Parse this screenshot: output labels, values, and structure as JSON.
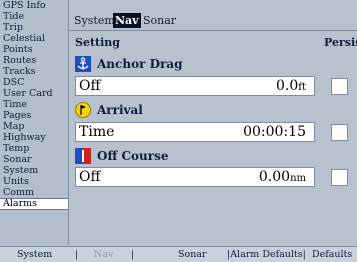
{
  "sidebar": {
    "items": [
      {
        "label": "GPS Info"
      },
      {
        "label": "Tide"
      },
      {
        "label": "Trip"
      },
      {
        "label": "Celestial"
      },
      {
        "label": "Points"
      },
      {
        "label": "Routes"
      },
      {
        "label": "Tracks"
      },
      {
        "label": "DSC"
      },
      {
        "label": "User Card"
      },
      {
        "label": "Time"
      },
      {
        "label": "Pages"
      },
      {
        "label": "Map"
      },
      {
        "label": "Highway"
      },
      {
        "label": "Temp"
      },
      {
        "label": "Sonar"
      },
      {
        "label": "System"
      },
      {
        "label": "Units"
      },
      {
        "label": "Comm"
      },
      {
        "label": "Alarms"
      }
    ],
    "active": "Alarms"
  },
  "tabs": [
    {
      "label": "System"
    },
    {
      "label": "Nav"
    },
    {
      "label": "Sonar"
    }
  ],
  "active_tab": "Nav",
  "headers": {
    "setting": "Setting",
    "persist": "Persist"
  },
  "alarms": [
    {
      "label": "Anchor Drag",
      "icon": "anchor-icon",
      "name": "Off",
      "value": "0.0",
      "unit": "ft",
      "persist": false
    },
    {
      "label": "Arrival",
      "icon": "arrival-flag-icon",
      "name": "Time",
      "value": "00:00:15",
      "unit": "",
      "persist": false
    },
    {
      "label": "Off Course",
      "icon": "off-course-icon",
      "name": "Off",
      "value": "0.00",
      "unit": "nm",
      "persist": false
    }
  ],
  "bottom_bar": {
    "system": "System",
    "sep1": "|",
    "nav": "Nav",
    "sep2": "|",
    "sonar": "Sonar",
    "alarm_defaults": "|Alarm Defaults|",
    "defaults": "Defaults"
  },
  "colors": {
    "accent_dark": "#0a1220",
    "background": "#b8c2ce",
    "icon_blue": "#1e4fc2",
    "icon_yellow": "#f6d400",
    "icon_red": "#d02020"
  }
}
